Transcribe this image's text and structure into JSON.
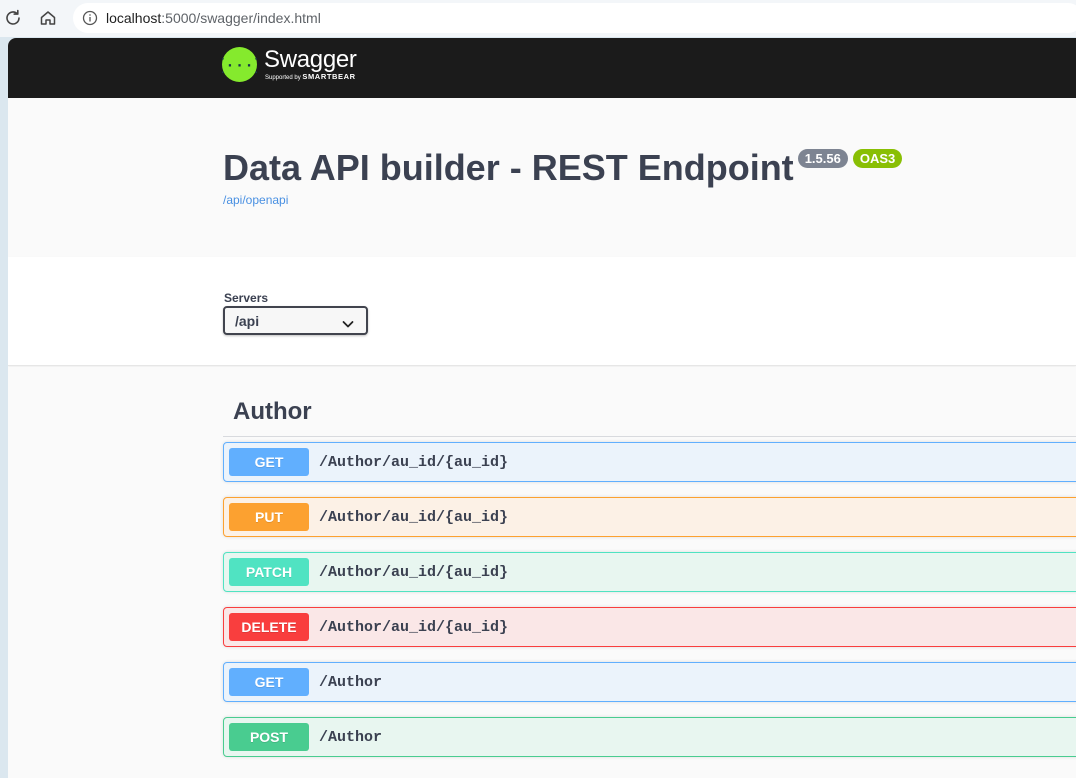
{
  "browser": {
    "url_host": "localhost",
    "url_rest": ":5000/swagger/index.html"
  },
  "swagger": {
    "logo_name": "Swagger",
    "logo_sub_prefix": "Supported by ",
    "logo_sub_brand": "SMARTBEAR",
    "title": "Data API builder - REST Endpoint",
    "version_badge": "1.5.56",
    "oas_badge": "OAS3",
    "spec_link": "/api/openapi"
  },
  "servers": {
    "label": "Servers",
    "selected": "/api"
  },
  "tag": {
    "name": "Author"
  },
  "operations": [
    {
      "method": "GET",
      "path": "/Author/au_id/{au_id}"
    },
    {
      "method": "PUT",
      "path": "/Author/au_id/{au_id}"
    },
    {
      "method": "PATCH",
      "path": "/Author/au_id/{au_id}"
    },
    {
      "method": "DELETE",
      "path": "/Author/au_id/{au_id}"
    },
    {
      "method": "GET",
      "path": "/Author"
    },
    {
      "method": "POST",
      "path": "/Author"
    }
  ],
  "colors": {
    "get": "#61affe",
    "put": "#fca130",
    "patch": "#50e3c2",
    "delete": "#f93e3e",
    "post": "#49cc90",
    "topbar": "#1b1b1b",
    "logo": "#85ea2d"
  }
}
